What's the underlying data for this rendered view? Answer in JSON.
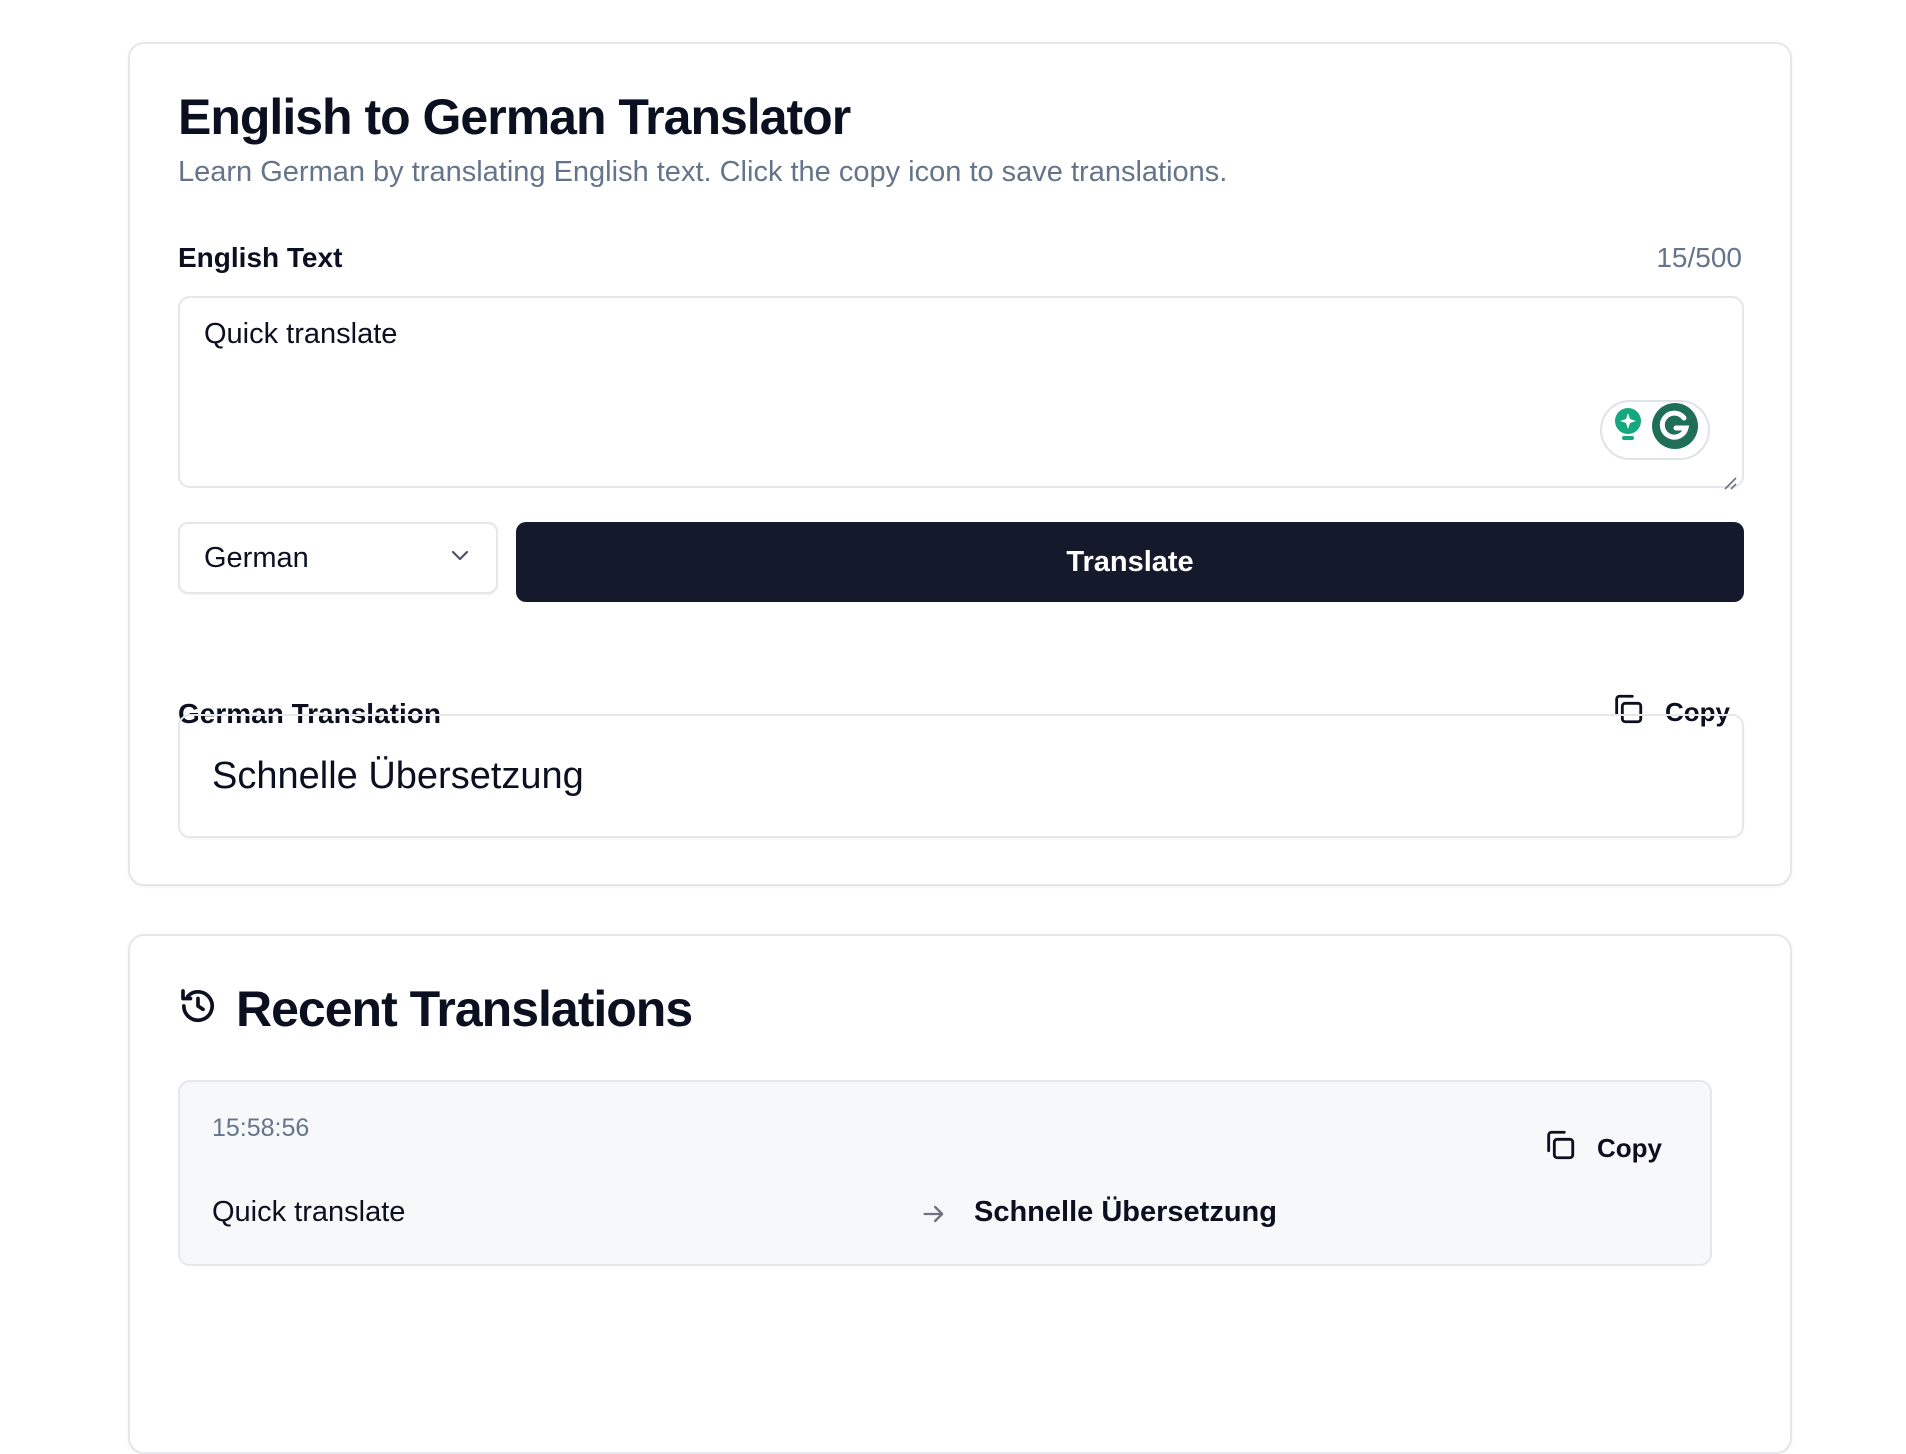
{
  "translator": {
    "title": "English to German Translator",
    "subtitle": "Learn German by translating English text. Click the copy icon to save translations.",
    "input_label": "English Text",
    "char_count": "15/500",
    "input_value": "Quick translate",
    "language_select": {
      "selected": "German"
    },
    "translate_button": "Translate",
    "output_label": "German Translation",
    "copy_label": "Copy",
    "output_value": "Schnelle Übersetzung"
  },
  "recent": {
    "title": "Recent Translations",
    "items": [
      {
        "time": "15:58:56",
        "source": "Quick translate",
        "target": "Schnelle Übersetzung",
        "copy_label": "Copy"
      }
    ]
  },
  "icons": {
    "history": "history-icon",
    "copy": "copy-icon",
    "chevron": "chevron-down-icon",
    "arrow": "arrow-right-icon",
    "grammarly": "grammarly-icon"
  },
  "colors": {
    "primary_button": "#141a2b",
    "muted_text": "#64748b",
    "border": "#e5e7eb",
    "grammarly_green": "#15a87e"
  }
}
